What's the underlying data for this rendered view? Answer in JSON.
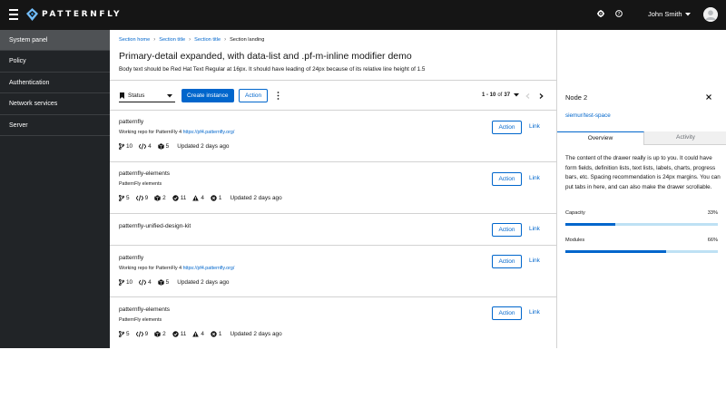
{
  "masthead": {
    "brand": "PATTERNFLY",
    "user_name": "John Smith",
    "icons": [
      "hamburger-icon",
      "patternfly-logo-icon",
      "gear-icon",
      "help-icon",
      "caret-down-icon",
      "avatar"
    ]
  },
  "sidebar": {
    "items": [
      {
        "label": "System panel",
        "active": true
      },
      {
        "label": "Policy",
        "active": false
      },
      {
        "label": "Authentication",
        "active": false
      },
      {
        "label": "Network services",
        "active": false
      },
      {
        "label": "Server",
        "active": false
      }
    ]
  },
  "breadcrumb": [
    "Section home",
    "Section title",
    "Section title",
    "Section landing"
  ],
  "page": {
    "title": "Primary-detail expanded, with data-list and .pf-m-inline modifier demo",
    "description": "Body text should be Red Hat Text Regular at 16px. It should have leading of 24px because of its relative line height of 1.5"
  },
  "toolbar": {
    "status_label": "Status",
    "create_label": "Create instance",
    "action_label": "Action",
    "pagination_range": "1 - 10",
    "pagination_of": "of",
    "pagination_total": "37"
  },
  "rows": [
    {
      "title": "patternfly",
      "sub_text": "Working repo for PatternFly 4 ",
      "sub_link": "https://pf4.patternfly.org/",
      "branches": "10",
      "code": "4",
      "cubes": "5",
      "updated": "Updated 2 days ago",
      "action": "Action",
      "link": "Link"
    },
    {
      "title": "patternfly-elements",
      "sub_text": "PatternFly elements",
      "branches": "5",
      "code": "9",
      "cubes": "2",
      "checks": "11",
      "warnings": "4",
      "errors": "1",
      "updated": "Updated 2 days ago",
      "action": "Action",
      "link": "Link"
    },
    {
      "title": "patternfly-unified-design-kit",
      "action": "Action",
      "link": "Link"
    },
    {
      "title": "patternfly",
      "sub_text": "Working repo for PatternFly 4 ",
      "sub_link": "https://pf4.patternfly.org/",
      "branches": "10",
      "code": "4",
      "cubes": "5",
      "updated": "Updated 2 days ago",
      "action": "Action",
      "link": "Link"
    },
    {
      "title": "patternfly-elements",
      "sub_text": "PatternFly elements",
      "branches": "5",
      "code": "9",
      "cubes": "2",
      "checks": "11",
      "warnings": "4",
      "errors": "1",
      "updated": "Updated 2 days ago",
      "action": "Action",
      "link": "Link"
    }
  ],
  "drawer": {
    "title": "Node 2",
    "link": "siemur/test-space",
    "tab_overview": "Overview",
    "tab_activity": "Activity",
    "body": "The content of the drawer really is up to you. It could have form fields, definition lists, text lists, labels, charts, progress bars, etc. Spacing recommendation is 24px margins. You can put tabs in here, and can also make the drawer scrollable.",
    "capacity_label": "Capacity",
    "capacity_value": "33%",
    "capacity_fraction": 0.33,
    "modules_label": "Modules",
    "modules_value": "66%",
    "modules_fraction": 0.66
  },
  "colors": {
    "accent": "#0066cc",
    "masthead": "#151515",
    "sidebar": "#212427",
    "sidebar_active": "#4f5255"
  }
}
